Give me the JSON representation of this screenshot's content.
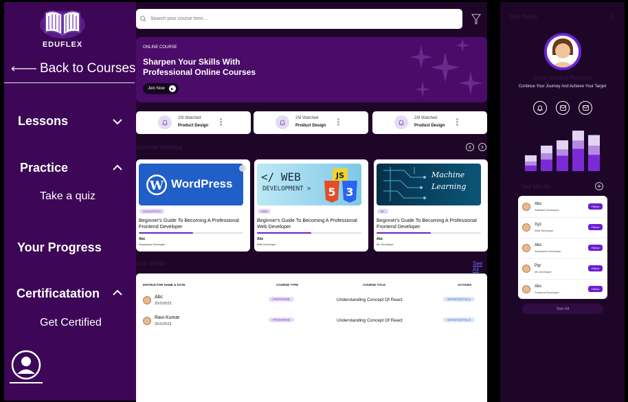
{
  "brand": {
    "name": "EDUFLEX"
  },
  "sidebar": {
    "back_label": "Back to Courses",
    "sections": [
      {
        "label": "Lessons",
        "chevron": "down"
      },
      {
        "label": "Practice",
        "chevron": "up",
        "sub": "Take a quiz"
      },
      {
        "label": "Your Progress"
      },
      {
        "label": "Certificatation",
        "chevron": "up",
        "sub": "Get Certified"
      }
    ]
  },
  "search": {
    "placeholder": "Search your course here...."
  },
  "banner": {
    "tag": "ONLINE COURSE",
    "title": "Sharpen  Your Skills With Professional Online Courses",
    "button": "Join Now"
  },
  "stats": [
    {
      "watched": "2/8 Watched",
      "name": "Product Design"
    },
    {
      "watched": "2/8 Watched",
      "name": "Product Design"
    },
    {
      "watched": "2/8 Watched",
      "name": "Product Design"
    }
  ],
  "continue": {
    "label": "Continue Watching"
  },
  "courses": [
    {
      "thumb_text": "WordPress",
      "tag": "WORDPRESS",
      "title": "Beginner's Guide To Becoming A Professional Frontend Developer",
      "progress": 0.52,
      "author": "Abc",
      "role": "Wordpress Developer"
    },
    {
      "thumb_text_1": "</ WEB",
      "thumb_text_2": "DEVELOPMENT >",
      "tag": "WEB",
      "title": "Beginner's Guide To Becoming A Professional Web Developer",
      "progress": 0.52,
      "author": "Abc",
      "role": "Web Developer"
    },
    {
      "thumb_text_1": "Machine",
      "thumb_text_2": "Learning",
      "tag": "ML",
      "title": "Beginner's Guide To Becoming A Professional Frontend Developer",
      "progress": 0.52,
      "author": "Abc",
      "role": "ML  Developer"
    }
  ],
  "mentor_table": {
    "label": "Your Mentor",
    "see_all": "See All",
    "headers": [
      "INSTRUCTOR NAME & DATE",
      "COURSE TYPE",
      "COURSE TITLE",
      "ACTIONS"
    ],
    "rows": [
      {
        "name": "Abc",
        "date": "25/2/2023",
        "type": "FRONTEND",
        "title": "Understanding Concept Of React",
        "action": "SHOW DETAILS"
      },
      {
        "name": "Ravi Kumar",
        "date": "25/2/2023",
        "type": "FRONTEND",
        "title": "Understanding Concept Of React",
        "action": "SHOW DETAILS"
      }
    ]
  },
  "profile": {
    "title": "Your Profile",
    "greeting": "Good Morning Prashant",
    "subtitle": "Continue Your Journey And Achieve Your Target",
    "icons": [
      "bell-icon",
      "mail-icon",
      "mail-icon"
    ],
    "bars": [
      {
        "segments": [
          0.35,
          0.25,
          0.4
        ]
      },
      {
        "segments": [
          0.45,
          0.25,
          0.3
        ]
      },
      {
        "segments": [
          0.5,
          0.2,
          0.3
        ]
      },
      {
        "segments": [
          0.55,
          0.2,
          0.25
        ]
      },
      {
        "segments": [
          0.45,
          0.25,
          0.3
        ]
      }
    ]
  },
  "mentors": {
    "label": "Your Mentor",
    "follow_label": "Follow",
    "see_all": "See All",
    "items": [
      {
        "name": "Abc",
        "role": "Software Developer"
      },
      {
        "name": "Xyz",
        "role": "Web Developer"
      },
      {
        "name": "Abc",
        "role": "Wordpress Developer"
      },
      {
        "name": "Pqr",
        "role": "ML  Developer"
      },
      {
        "name": "Abc",
        "role": "Frontend Developer"
      }
    ]
  },
  "colors": {
    "sidebar": "#3d0656",
    "accent": "#6b1fd0",
    "banner": "#4a0b69",
    "background": "#1f0629"
  }
}
